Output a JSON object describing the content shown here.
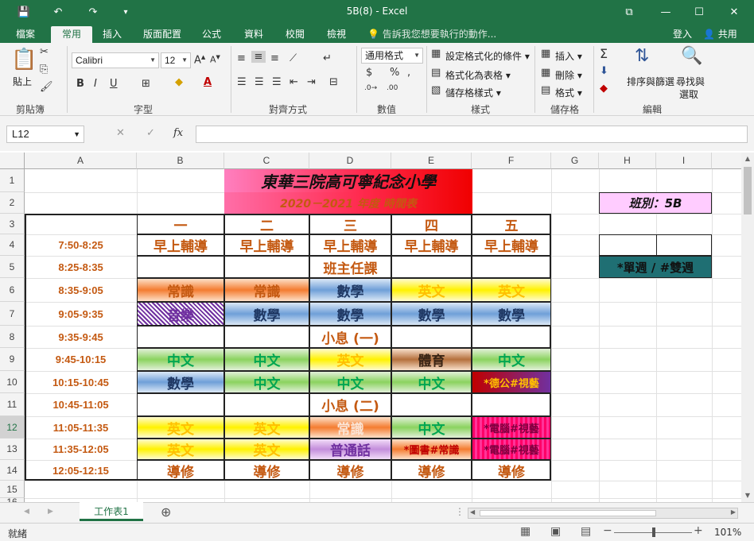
{
  "titlebar": {
    "title": "5B(8) - Excel",
    "save": "💾",
    "undo": "↶",
    "redo": "↷",
    "customize": "▾",
    "restore": "⧉",
    "minimize": "—",
    "maximize": "☐",
    "close": "✕"
  },
  "tabs": [
    "檔案",
    "常用",
    "插入",
    "版面配置",
    "公式",
    "資料",
    "校閱",
    "檢視"
  ],
  "tell_me": "告訴我您想要執行的動作...",
  "login": "登入",
  "share": "共用",
  "ribbon": {
    "paste": "貼上",
    "font_name": "Calibri",
    "font_size": "12",
    "number_format": "通用格式",
    "conditional_format": "設定格式化的條件",
    "format_as_table": "格式化為表格",
    "cell_styles": "儲存格樣式",
    "insert": "插入",
    "delete": "刪除",
    "format": "格式",
    "sort_filter_1": "排序與篩選",
    "find_select_1": "尋找與",
    "find_select_2": "選取",
    "groups": {
      "clipboard": "剪貼簿",
      "font": "字型",
      "alignment": "對齊方式",
      "number": "數值",
      "styles": "樣式",
      "cells": "儲存格",
      "editing": "編輯"
    }
  },
  "formula_bar": {
    "name_box": "L12",
    "fx": "fx",
    "content": ""
  },
  "columns": [
    "A",
    "B",
    "C",
    "D",
    "E",
    "F",
    "G",
    "H",
    "I"
  ],
  "rows": [
    "1",
    "2",
    "3",
    "4",
    "5",
    "6",
    "7",
    "8",
    "9",
    "10",
    "11",
    "12",
    "13",
    "14",
    "15",
    "16"
  ],
  "sheet": {
    "title": "東華三院高可寧紀念小學",
    "subtitle": "2020－2021 年度 時間表",
    "class_label": "班別：5B",
    "legend": "*單週 / #雙週",
    "days": [
      "一",
      "二",
      "三",
      "四",
      "五"
    ],
    "times": [
      "7:50-8:25",
      "8:25-8:35",
      "8:35-9:05",
      "9:05-9:35",
      "9:35-9:45",
      "9:45-10:15",
      "10:15-10:45",
      "10:45-11:05",
      "11:05-11:35",
      "11:35-12:05",
      "12:05-12:15"
    ],
    "row4": [
      "早上輔導",
      "早上輔導",
      "早上輔導",
      "早上輔導",
      "早上輔導"
    ],
    "row5": "班主任課",
    "row6": [
      "常識",
      "常識",
      "數學",
      "英文",
      "英文"
    ],
    "row7": [
      "音樂",
      "數學",
      "數學",
      "數學",
      "數學"
    ],
    "row8": "小息 (一)",
    "row9": [
      "中文",
      "中文",
      "英文",
      "體育",
      "中文"
    ],
    "row10": [
      "數學",
      "中文",
      "中文",
      "中文",
      "*德公#視藝"
    ],
    "row11": "小息 (二)",
    "row12": [
      "英文",
      "英文",
      "常識",
      "中文",
      "*電腦#視藝"
    ],
    "row13": [
      "英文",
      "英文",
      "普通話",
      "*圖書#常識",
      "*電腦#視藝"
    ],
    "row14": [
      "導修",
      "導修",
      "導修",
      "導修",
      "導修"
    ]
  },
  "sheet_tab": "工作表1",
  "status": {
    "ready": "就緒",
    "zoom": "101%"
  }
}
